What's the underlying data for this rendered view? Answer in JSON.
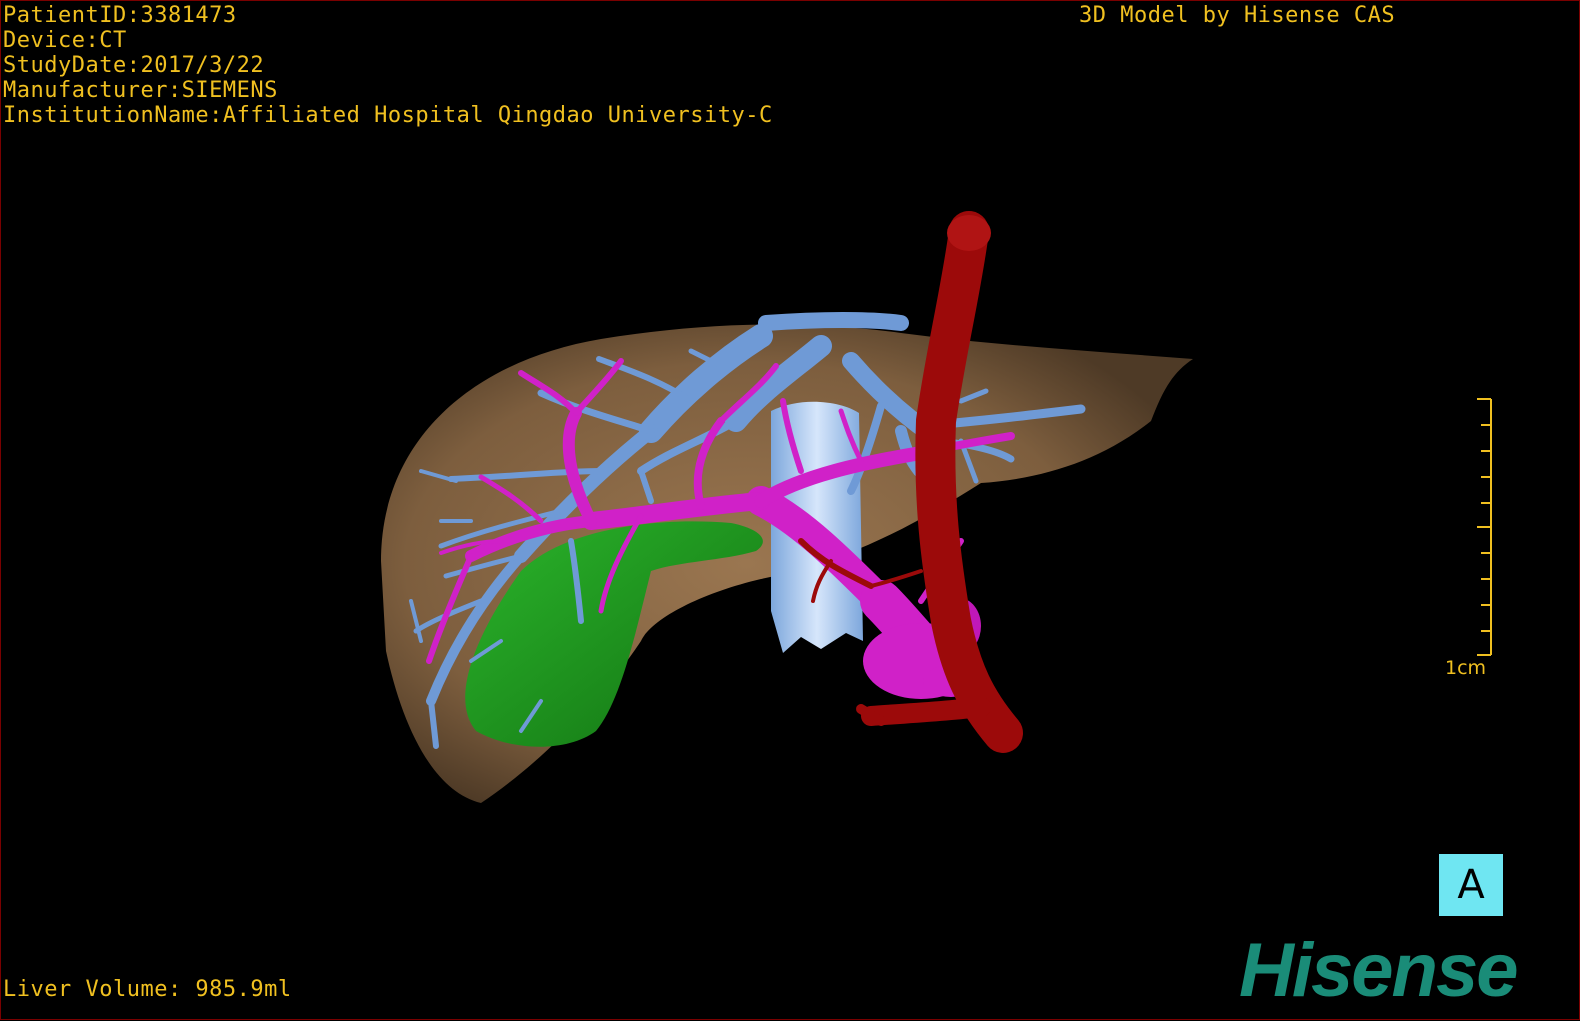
{
  "info": {
    "patient_id": "PatientID:3381473",
    "device": "Device:CT",
    "study_date": "StudyDate:2017/3/22",
    "manufacturer": "Manufacturer:SIEMENS",
    "institution": "InstitutionName:Affiliated Hospital Qingdao University-C"
  },
  "credit": "3D Model by Hisense CAS",
  "ruler": {
    "label": "1cm"
  },
  "orientation": "A",
  "liver_volume": "Liver Volume: 985.9ml",
  "brand": "Hisense",
  "colors": {
    "text": "#f0c020",
    "liver": "#8a6a46",
    "hepatic_vein": "#6f9ad6",
    "portal_vein": "#d021c8",
    "artery": "#9c0a0a",
    "gallbladder": "#1e9a1e",
    "ivc": "#a9c8ee",
    "orientation_box": "#6fe6f2",
    "brand": "#1a8c78"
  }
}
